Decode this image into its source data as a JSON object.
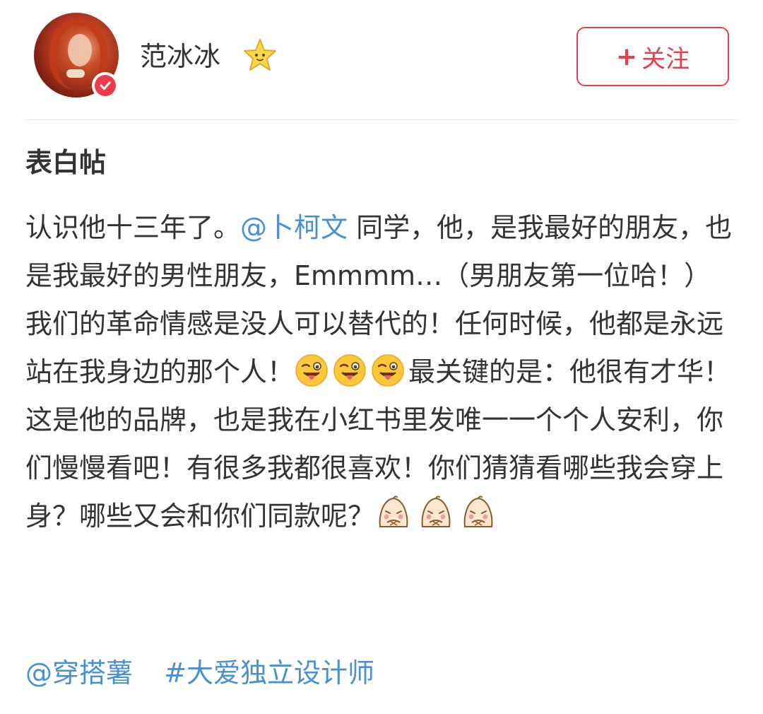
{
  "header": {
    "username": "范冰冰",
    "follow_label": "关注",
    "follow_plus": "+"
  },
  "post": {
    "title": "表白帖",
    "body": {
      "p1_a": "认识他十三年了。",
      "mention_1": "@卜柯文",
      "p1_b": " 同学，他，是我最好的朋友，也是我最好的男性朋友，Emmmm…（男朋友第一位哈！）",
      "p2_a": "我们的革命情感是没人可以替代的！任何时候，他都是永远站在我身边的那个人！",
      "p2_b": "最关键的是：他很有才华！这是他的品牌，也是我在小红书里发唯一一个个人安利，你们慢慢看吧！有很多我都很喜欢！你们猜猜看哪些我会穿上身？哪些又会和你们同款呢？"
    }
  },
  "tags": {
    "mention": "@穿搭薯",
    "hashtag": "#大爱独立设计师"
  },
  "colors": {
    "accent": "#e2404f",
    "link": "#4a90d0",
    "text": "#333333",
    "verified": "#ef3b4c"
  },
  "icons": {
    "avatar": "avatar-photo",
    "verified": "verified-badge-icon",
    "level": "star-icon",
    "emoji_tongue": "tongue-out-wink-emoji",
    "emoji_shy": "shy-blush-emoji"
  }
}
